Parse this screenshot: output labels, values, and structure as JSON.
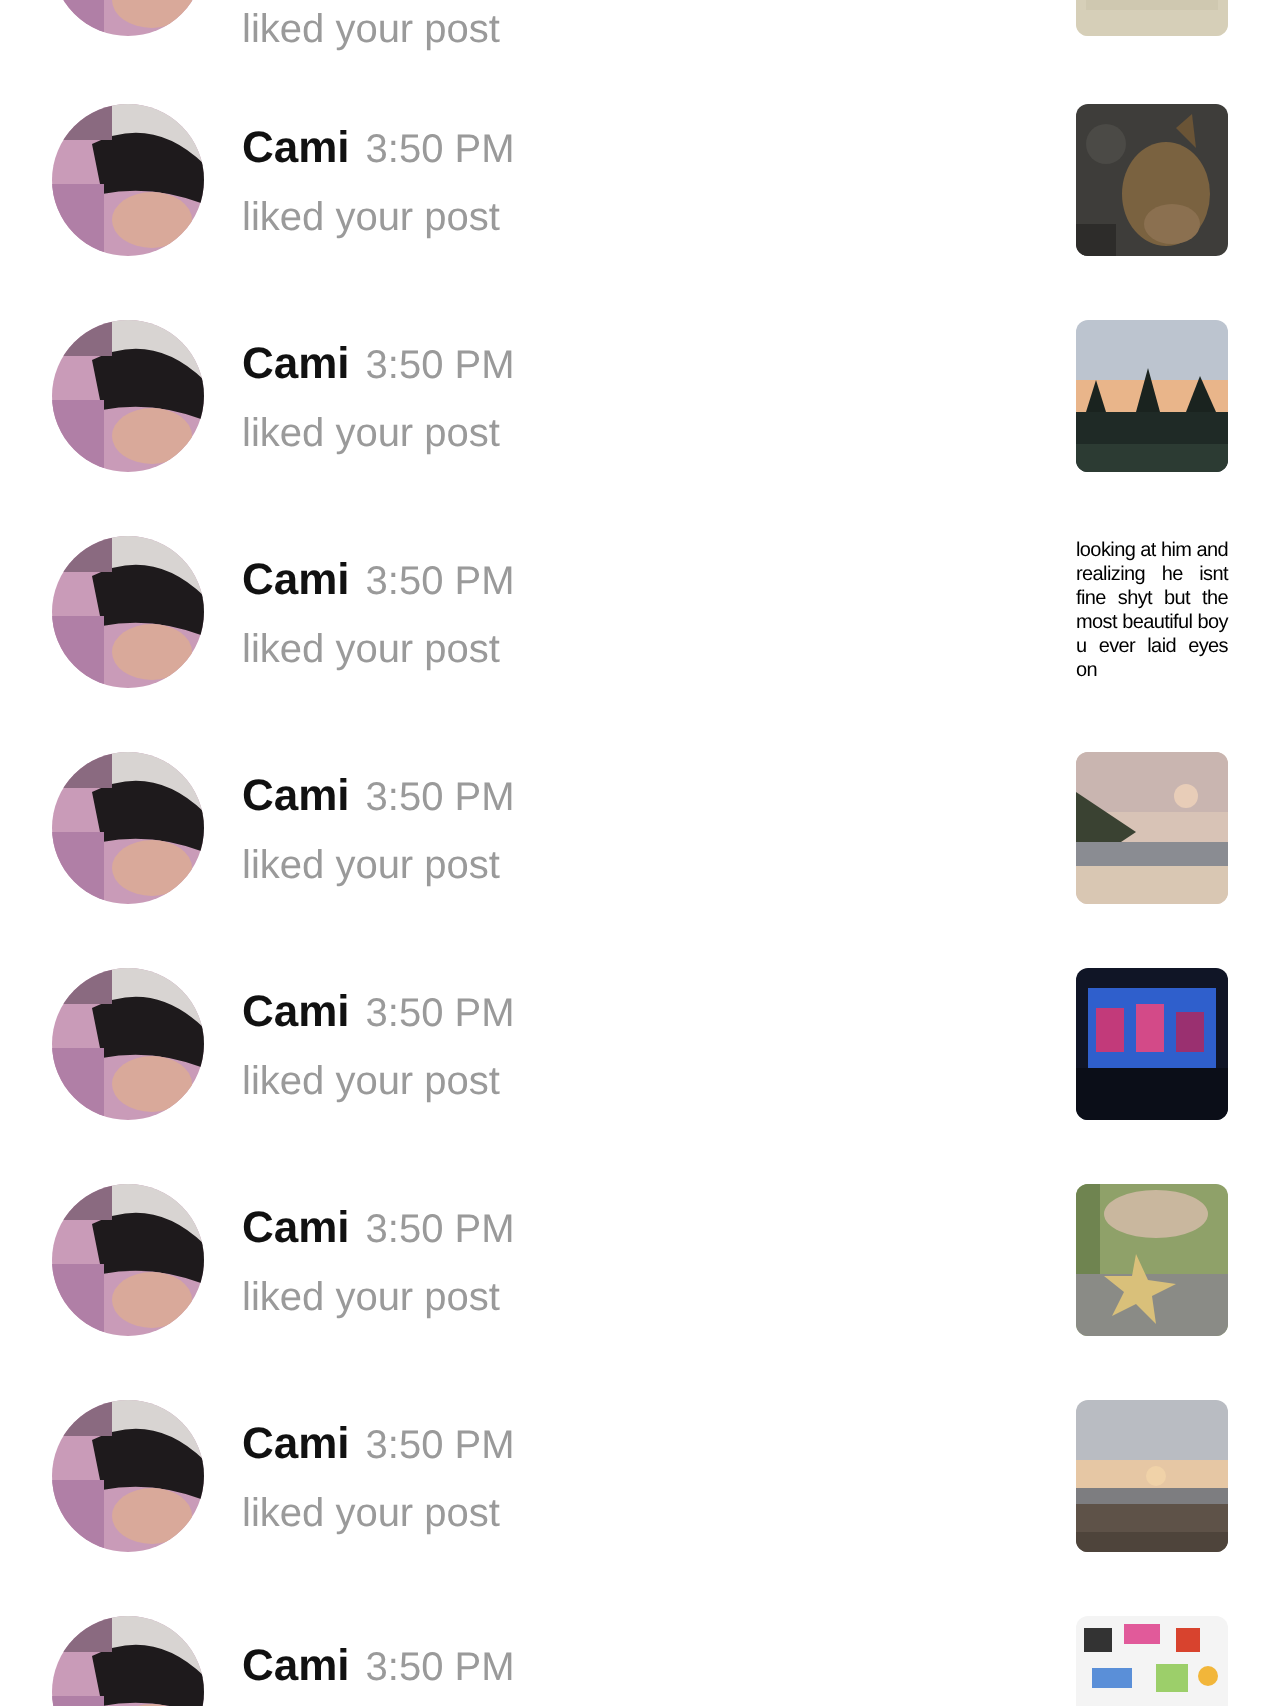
{
  "notifications": [
    {
      "action": "liked your post"
    },
    {
      "name": "Cami",
      "time": "3:50 PM",
      "action": "liked your post"
    },
    {
      "name": "Cami",
      "time": "3:50 PM",
      "action": "liked your post"
    },
    {
      "name": "Cami",
      "time": "3:50 PM",
      "action": "liked your post",
      "thumbnail": {
        "kind": "text",
        "text": "looking at him and realizing he isnt fine shyt but the most beautiful boy u ever laid eyes on"
      }
    },
    {
      "name": "Cami",
      "time": "3:50 PM",
      "action": "liked your post"
    },
    {
      "name": "Cami",
      "time": "3:50 PM",
      "action": "liked your post"
    },
    {
      "name": "Cami",
      "time": "3:50 PM",
      "action": "liked your post"
    },
    {
      "name": "Cami",
      "time": "3:50 PM",
      "action": "liked your post"
    },
    {
      "name": "Cami",
      "time": "3:50 PM"
    }
  ]
}
